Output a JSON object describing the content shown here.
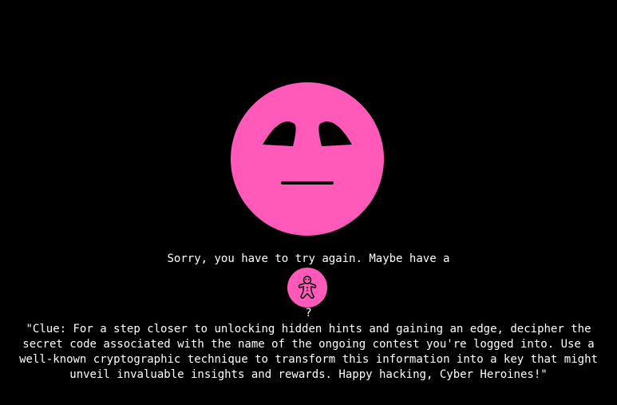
{
  "colors": {
    "background": "#000000",
    "accent": "#ff5ab9",
    "text": "#ffffff"
  },
  "face": {
    "icon": "sad-face-icon"
  },
  "message": {
    "sorry_text": "Sorry, you have to try again. Maybe have a",
    "cookie_icon": "gingerbread-man-icon",
    "question_mark": "?"
  },
  "clue": {
    "text": "\"Clue: For a step closer to unlocking hidden hints and gaining an edge, decipher the secret code associated with the name of the ongoing contest you're logged into. Use a well-known cryptographic technique to transform this information into a key that might unveil invaluable insights and rewards. Happy hacking, Cyber Heroines!\""
  }
}
